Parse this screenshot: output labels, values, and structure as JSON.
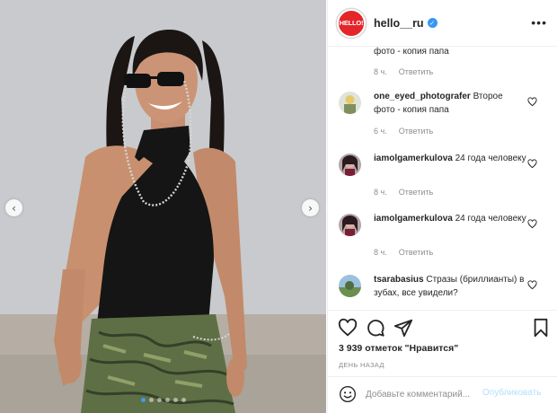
{
  "post": {
    "account": {
      "logo_text": "HELLO!",
      "username": "hello__ru",
      "verified": true,
      "brand_color": "#e4262a"
    },
    "carousel": {
      "slides": 6,
      "active_index": 0,
      "active_color": "#3d9bf2"
    },
    "comments": [
      {
        "username": "",
        "text": "фото - копия папа",
        "time": "8 ч.",
        "reply_label": "Ответить",
        "truncated": true
      },
      {
        "username": "one_eyed_photografer",
        "text": "Второе фото - копия папа",
        "time": "6 ч.",
        "reply_label": "Ответить"
      },
      {
        "username": "iamolgamerkulova",
        "text": "24 года человеку",
        "time": "8 ч.",
        "reply_label": "Ответить"
      },
      {
        "username": "iamolgamerkulova",
        "text": "24 года человеку",
        "time": "8 ч.",
        "reply_label": "Ответить"
      },
      {
        "username": "tsarabasius",
        "text": "Стразы (бриллианты) в зубах, все увидели?",
        "time": "",
        "reply_label": ""
      }
    ],
    "likes_text": "3 939 отметок \"Нравится\"",
    "date_text": "ДЕНЬ НАЗАД",
    "add_comment": {
      "placeholder": "Добавьте комментарий...",
      "post_label": "Опубликовать",
      "post_color": "#b2dffc"
    },
    "icons": {
      "like": "heart-icon",
      "comment": "comment-icon",
      "share": "share-icon",
      "save": "bookmark-icon",
      "emoji": "smile-icon",
      "more": "more-icon",
      "verified": "verified-badge-icon"
    }
  }
}
